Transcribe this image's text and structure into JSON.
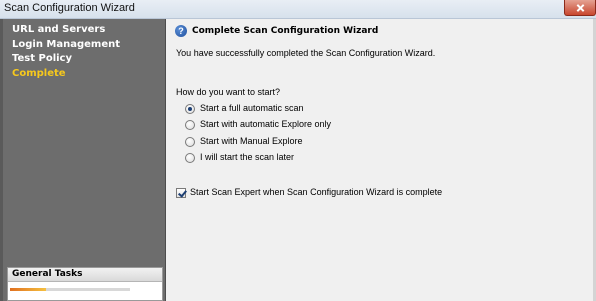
{
  "window": {
    "title": "Scan Configuration Wizard"
  },
  "sidebar": {
    "items": [
      {
        "label": "URL and Servers",
        "active": false
      },
      {
        "label": "Login Management",
        "active": false
      },
      {
        "label": "Test Policy",
        "active": false
      },
      {
        "label": "Complete",
        "active": true
      }
    ],
    "tasks_header": "General Tasks"
  },
  "content": {
    "header_title": "Complete Scan Configuration Wizard",
    "success_message": "You have successfully completed the Scan Configuration Wizard.",
    "question": "How do you want to start?",
    "options": [
      {
        "label": "Start a full automatic scan",
        "selected": true
      },
      {
        "label": "Start with automatic Explore only",
        "selected": false
      },
      {
        "label": "Start with Manual Explore",
        "selected": false
      },
      {
        "label": "I will start the scan later",
        "selected": false
      }
    ],
    "checkbox": {
      "label": "Start Scan Expert when Scan Configuration Wizard is complete",
      "checked": true
    }
  },
  "icons": {
    "help": "help-icon",
    "close": "close-icon"
  },
  "colors": {
    "sidebar_bg": "#6d6d6d",
    "active_item": "#f6c81d"
  }
}
